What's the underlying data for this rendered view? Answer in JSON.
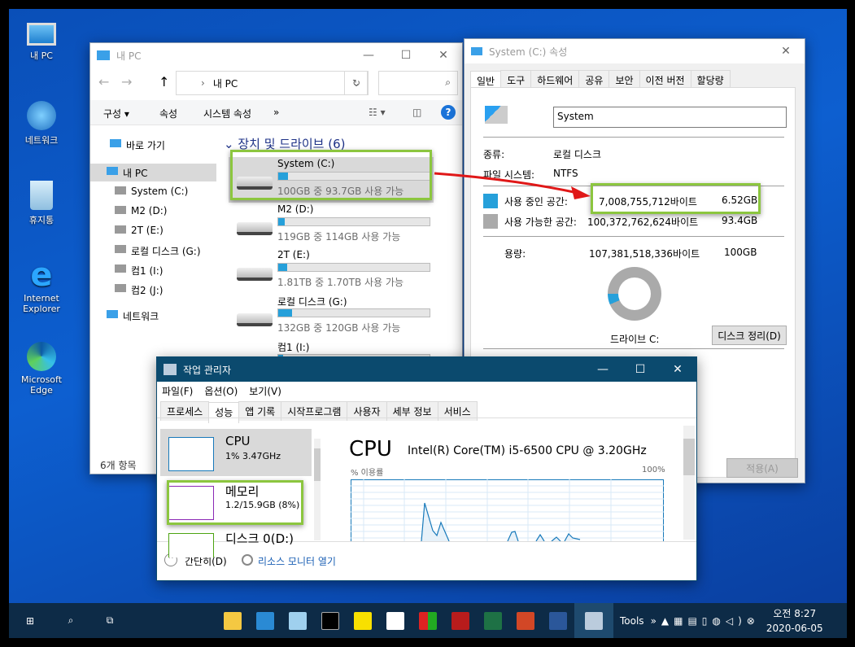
{
  "desktop": {
    "icons": [
      {
        "label": "내 PC",
        "icon": "computer-icon"
      },
      {
        "label": "네트워크",
        "icon": "network-icon"
      },
      {
        "label": "휴지통",
        "icon": "recycle-bin-icon"
      },
      {
        "label": "Internet Explorer",
        "icon": "ie-icon"
      },
      {
        "label": "Microsoft Edge",
        "icon": "edge-icon"
      }
    ]
  },
  "explorer": {
    "title": "내 PC",
    "address": "내 PC",
    "toolbar": {
      "organize": "구성",
      "properties": "속성",
      "system_properties": "시스템 속성",
      "more": "»"
    },
    "nav": [
      {
        "label": "바로 가기"
      },
      {
        "label": "내 PC"
      },
      {
        "label": "System (C:)"
      },
      {
        "label": "M2 (D:)"
      },
      {
        "label": "2T (E:)"
      },
      {
        "label": "로컬 디스크 (G:)"
      },
      {
        "label": "컴1 (I:)"
      },
      {
        "label": "컴2 (J:)"
      },
      {
        "label": "네트워크"
      }
    ],
    "group_title": "장치 및 드라이브 (6)",
    "drives": [
      {
        "name": "System (C:)",
        "info": "100GB 중 93.7GB 사용 가능",
        "used_pct": 6.3
      },
      {
        "name": "M2 (D:)",
        "info": "119GB 중 114GB 사용 가능",
        "used_pct": 4.2
      },
      {
        "name": "2T (E:)",
        "info": "1.81TB 중 1.70TB 사용 가능",
        "used_pct": 6.1
      },
      {
        "name": "로컬 디스크 (G:)",
        "info": "132GB 중 120GB 사용 가능",
        "used_pct": 9.1
      },
      {
        "name": "컴1 (I:)",
        "info": "",
        "used_pct": 3
      }
    ],
    "status": "6개 항목"
  },
  "props": {
    "title": "System (C:) 속성",
    "tabs": [
      "일반",
      "도구",
      "하드웨어",
      "공유",
      "보안",
      "이전 버전",
      "할당량"
    ],
    "name_value": "System",
    "type_label": "종류:",
    "type_value": "로컬 디스크",
    "fs_label": "파일 시스템:",
    "fs_value": "NTFS",
    "used_label": "사용 중인 공간:",
    "used_bytes": "7,008,755,712바이트",
    "used_gb": "6.52GB",
    "free_label": "사용 가능한 공간:",
    "free_bytes": "100,372,762,624바이트",
    "free_gb": "93.4GB",
    "cap_label": "용량:",
    "cap_bytes": "107,381,518,336바이트",
    "cap_gb": "100GB",
    "drive_label": "드라이브 C:",
    "cleanup": "디스크 정리(D)",
    "apply": "적용(A)",
    "used_color": "#26a0da",
    "free_color": "#aaaaaa",
    "used_fraction": 0.065
  },
  "taskmgr": {
    "title": "작업 관리자",
    "menu": [
      "파일(F)",
      "옵션(O)",
      "보기(V)"
    ],
    "tabs": [
      "프로세스",
      "성능",
      "앱 기록",
      "시작프로그램",
      "사용자",
      "세부 정보",
      "서비스"
    ],
    "side": [
      {
        "name": "CPU",
        "value": "1% 3.47GHz"
      },
      {
        "name": "메모리",
        "value": "1.2/15.9GB (8%)"
      },
      {
        "name": "디스크 0(D:)",
        "value": ""
      }
    ],
    "heading": "CPU",
    "cpu_name": "Intel(R) Core(TM) i5-6500 CPU @ 3.20GHz",
    "usage_label": "% 이용률",
    "max_label": "100%",
    "fewer": "간단히(D)",
    "resmon": "리소스 모니터 열기"
  },
  "taskbar": {
    "tools": "Tools",
    "time": "오전 8:27",
    "date": "2020-06-05"
  }
}
